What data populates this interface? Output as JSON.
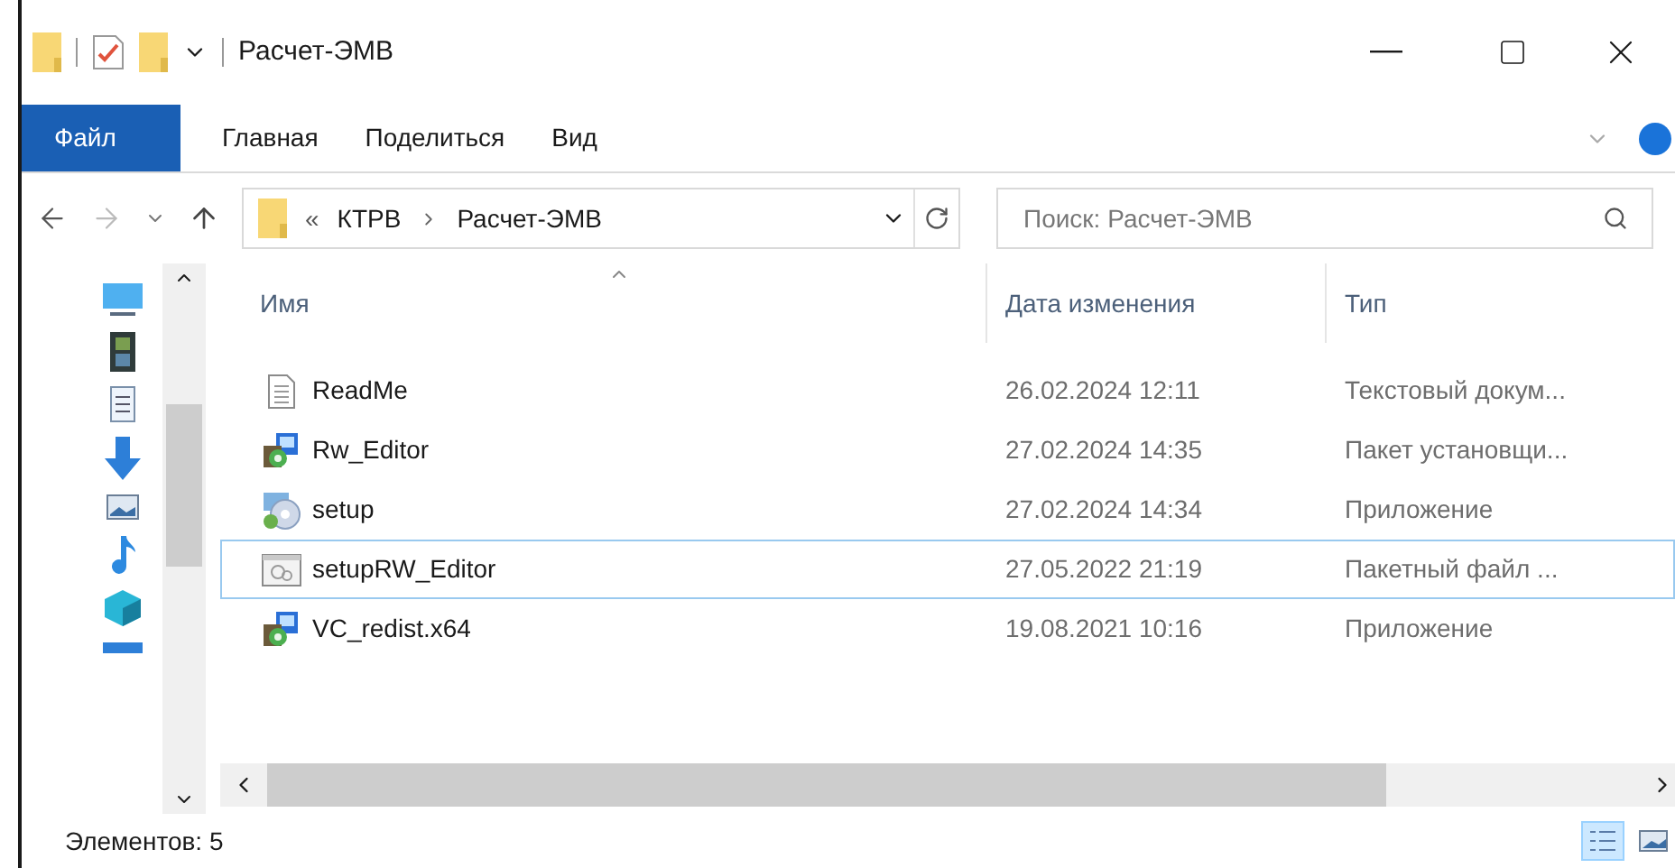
{
  "window": {
    "title": "Расчет-ЭМВ"
  },
  "ribbon": {
    "tabs": [
      {
        "label": "Файл",
        "kind": "file"
      },
      {
        "label": "Главная",
        "kind": "tab"
      },
      {
        "label": "Поделиться",
        "kind": "tab"
      },
      {
        "label": "Вид",
        "kind": "tab"
      }
    ]
  },
  "address_bar": {
    "overflow": "«",
    "crumbs": [
      "КТРВ",
      "Расчет-ЭМВ"
    ]
  },
  "search": {
    "placeholder": "Поиск: Расчет-ЭМВ"
  },
  "table": {
    "columns": [
      "Имя",
      "Дата изменения",
      "Тип"
    ],
    "rows": [
      {
        "name": "ReadMe",
        "date": "26.02.2024 12:11",
        "type": "Текстовый докум...",
        "kind": "text",
        "selected": false
      },
      {
        "name": "Rw_Editor",
        "date": "27.02.2024 14:35",
        "type": "Пакет установщи...",
        "kind": "installer",
        "selected": false
      },
      {
        "name": "setup",
        "date": "27.02.2024 14:34",
        "type": "Приложение",
        "kind": "setup",
        "selected": false
      },
      {
        "name": "setupRW_Editor",
        "date": "27.05.2022 21:19",
        "type": "Пакетный файл ...",
        "kind": "batch",
        "selected": true
      },
      {
        "name": "VC_redist.x64",
        "date": "19.08.2021 10:16",
        "type": "Приложение",
        "kind": "installer",
        "selected": false
      }
    ]
  },
  "status_bar": {
    "item_count": "Элементов: 5",
    "views": [
      {
        "kind": "details",
        "selected": true
      },
      {
        "kind": "thumbnails",
        "selected": false
      }
    ]
  }
}
